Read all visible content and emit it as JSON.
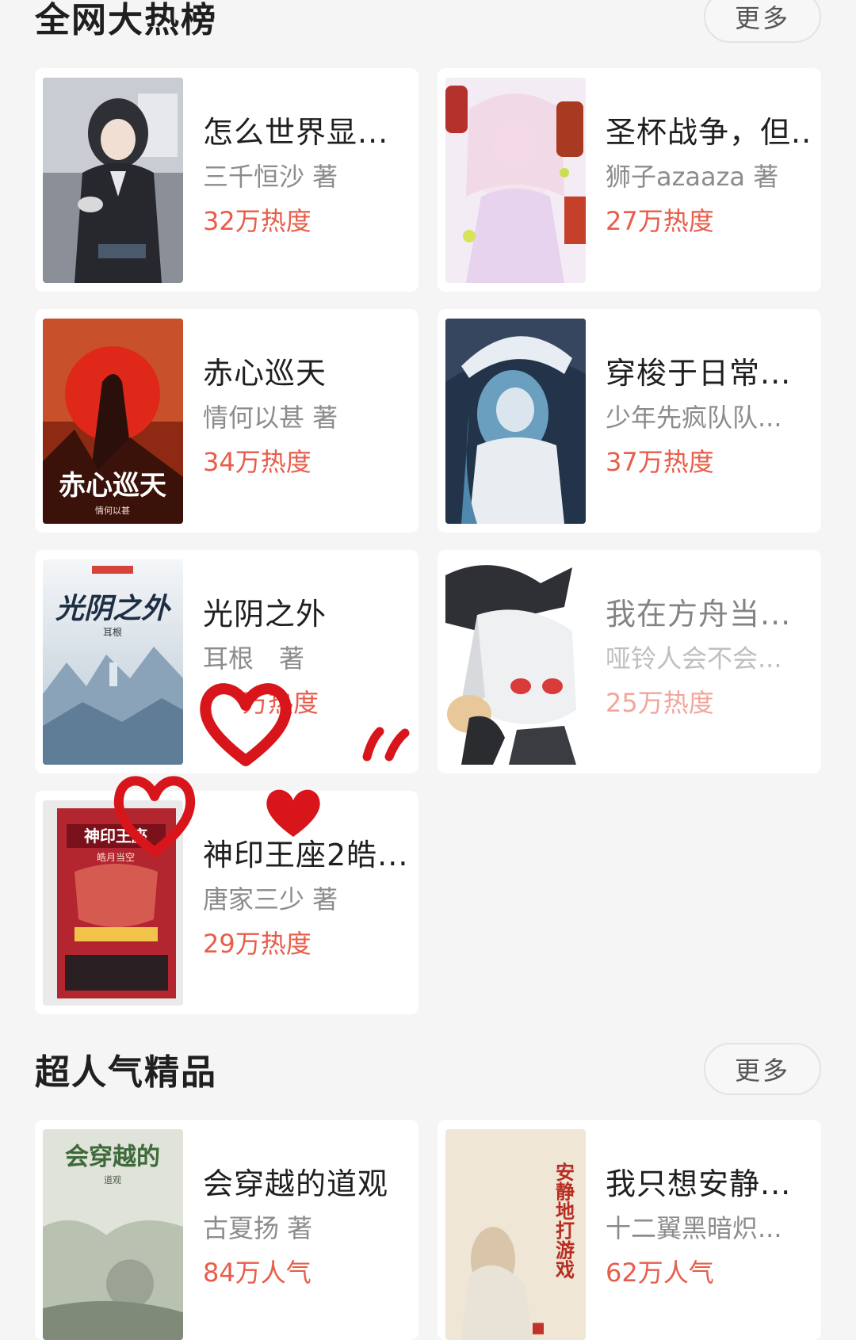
{
  "hot": {
    "title": "全网大热榜",
    "more": "更多",
    "books": [
      {
        "title": "怎么世界显...",
        "author": "三千恒沙 著",
        "heat": "32万热度"
      },
      {
        "title": "圣杯战争，但...",
        "author": "狮子azaaza 著",
        "heat": "27万热度"
      },
      {
        "title": "赤心巡天",
        "author": "情何以甚 著",
        "heat": "34万热度",
        "cover_text": "赤心巡天",
        "cover_sub": "情何以甚"
      },
      {
        "title": "穿梭于日常...",
        "author": "少年先疯队队...",
        "heat": "37万热度"
      },
      {
        "title": "光阴之外",
        "author": "耳根　著",
        "heat": "万热度",
        "cover_text": "光阴之外",
        "cover_sub": "耳根"
      },
      {
        "title": "我在方舟当...",
        "author": "哑铃人会不会...",
        "heat": "25万热度"
      },
      {
        "title": "神印王座2皓...",
        "author": "唐家三少 著",
        "heat": "29万热度",
        "cover_text": "神印王座",
        "cover_sub": "皓月当空"
      }
    ]
  },
  "popular": {
    "title": "超人气精品",
    "more": "更多",
    "books": [
      {
        "title": "会穿越的道观",
        "author": "古夏扬 著",
        "heat": "84万人气",
        "cover_text": "会穿越的",
        "cover_sub": "道观"
      },
      {
        "title": "我只想安静...",
        "author": "十二翼黑暗炽...",
        "heat": "62万人气",
        "cover_text": "安静地打游戏"
      }
    ]
  },
  "colors": {
    "accent": "#e85d4a",
    "background": "#f5f5f6",
    "card": "#ffffff",
    "doodle": "#d8151b"
  }
}
